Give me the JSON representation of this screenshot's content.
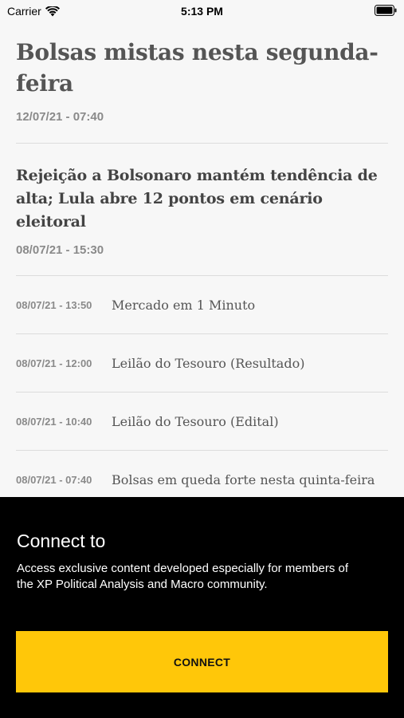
{
  "status_bar": {
    "carrier": "Carrier",
    "time": "5:13 PM",
    "wifi_icon": "wifi-icon",
    "battery_icon": "battery-icon"
  },
  "featured": {
    "title": "Bolsas mistas nesta segunda-feira",
    "date": "12/07/21 - 07:40"
  },
  "second": {
    "title": "Rejeição a Bolsonaro mantém tendência de alta; Lula abre 12 pontos em cenário eleitoral",
    "date": "08/07/21 - 15:30"
  },
  "list": [
    {
      "time": "08/07/21 - 13:50",
      "title": "Mercado em 1 Minuto"
    },
    {
      "time": "08/07/21 - 12:00",
      "title": "Leilão do Tesouro (Resultado)"
    },
    {
      "time": "08/07/21 - 10:40",
      "title": "Leilão do Tesouro (Edital)"
    },
    {
      "time": "08/07/21 - 07:40",
      "title": "Bolsas em queda forte nesta quinta-feira"
    }
  ],
  "overlay": {
    "heading": "Connect to",
    "description": "Access exclusive content developed especially for members of the XP Political Analysis and Macro community.",
    "button_label": "CONNECT"
  },
  "colors": {
    "accent": "#ffc709",
    "overlay_bg": "#000000",
    "background": "#f7f7f7"
  }
}
